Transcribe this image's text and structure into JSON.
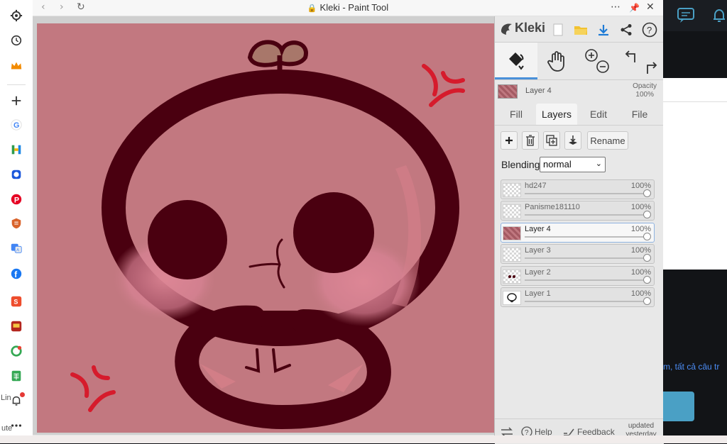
{
  "window": {
    "title": "Kleki - Paint Tool"
  },
  "sidebar": {
    "left_text": "Lin",
    "left_text2": "ute"
  },
  "app": {
    "logo": "Kleki",
    "current_layer": {
      "name": "Layer 4",
      "opacity_label": "Opacity",
      "opacity_value": "100%"
    },
    "tabs": [
      "Fill",
      "Layers",
      "Edit",
      "File"
    ],
    "active_tab": "Layers",
    "rename_label": "Rename",
    "blending_label": "Blending",
    "blending_value": "normal",
    "layers": [
      {
        "name": "hd247",
        "opacity": "100%"
      },
      {
        "name": "Panisme181110",
        "opacity": "100%"
      },
      {
        "name": "Layer 4",
        "opacity": "100%"
      },
      {
        "name": "Layer 3",
        "opacity": "100%"
      },
      {
        "name": "Layer 2",
        "opacity": "100%"
      },
      {
        "name": "Layer 1",
        "opacity": "100%"
      }
    ],
    "active_layer": "Layer 4",
    "footer": {
      "help": "Help",
      "feedback": "Feedback",
      "updated_line1": "updated",
      "updated_line2": "yesterday"
    }
  },
  "background_page": {
    "link_text": "m, tất cả câu tr"
  },
  "colors": {
    "canvas_bg": "#c27880",
    "ink": "#4a0010",
    "blush": "#d9808e",
    "red_mark": "#d61b2c",
    "accent": "#4a90d9"
  }
}
